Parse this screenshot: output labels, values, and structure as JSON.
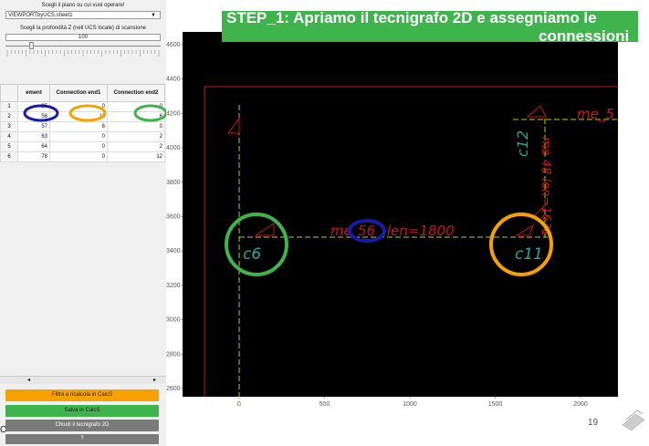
{
  "left_panel": {
    "plane_label": "Scegli il piano su cui vuoi operare!",
    "plane_value": "VIEWPORTbyUCS.sheet1",
    "depth_label": "Scegli la profondità Z (nell UCS locale) di scansione",
    "depth_value": "100",
    "table": {
      "columns": [
        "ement",
        "Connection end1",
        "Connection end2"
      ],
      "rows": [
        {
          "n": "1",
          "element": "35",
          "end1": "0",
          "end2": "0"
        },
        {
          "n": "2",
          "element": "56",
          "end1": "11",
          "end2": "6"
        },
        {
          "n": "3",
          "element": "57",
          "end1": "6",
          "end2": "0"
        },
        {
          "n": "4",
          "element": "63",
          "end1": "0",
          "end2": "2"
        },
        {
          "n": "5",
          "element": "64",
          "end1": "0",
          "end2": "2"
        },
        {
          "n": "6",
          "element": "78",
          "end1": "0",
          "end2": "12"
        }
      ]
    },
    "buttons": {
      "filter": "Filtra e ricalcola in CalcS",
      "save": "Salva in CalcS",
      "close": "Chiudi il tecnigrafo 2D",
      "help": "?"
    }
  },
  "title": {
    "line1": "STEP_1: Apriamo il tecnigrafo 2D e assegniamo le",
    "line2": "connessioni"
  },
  "page_number": "19",
  "stray_char": "C",
  "plot": {
    "y_ticks": [
      "4600",
      "4400",
      "4200",
      "4000",
      "3800",
      "3600",
      "3400",
      "3200",
      "3000",
      "2800",
      "2600"
    ],
    "x_ticks": [
      "0",
      "500",
      "1000",
      "1500",
      "2000"
    ],
    "labels": {
      "c6": "c6",
      "c11": "c11",
      "c12": "c12",
      "member_left": "me",
      "member_num": "56",
      "member_len": "len=1800",
      "member_right_top": "me_5",
      "member_vertical": "me 48 len=1631"
    }
  },
  "colors": {
    "green": "#3fb44c",
    "orange": "#f5a200",
    "blue": "#1a1aa8",
    "red": "#c8141e",
    "cyan": "#1fa8a0",
    "yellow": "#c8c800"
  }
}
